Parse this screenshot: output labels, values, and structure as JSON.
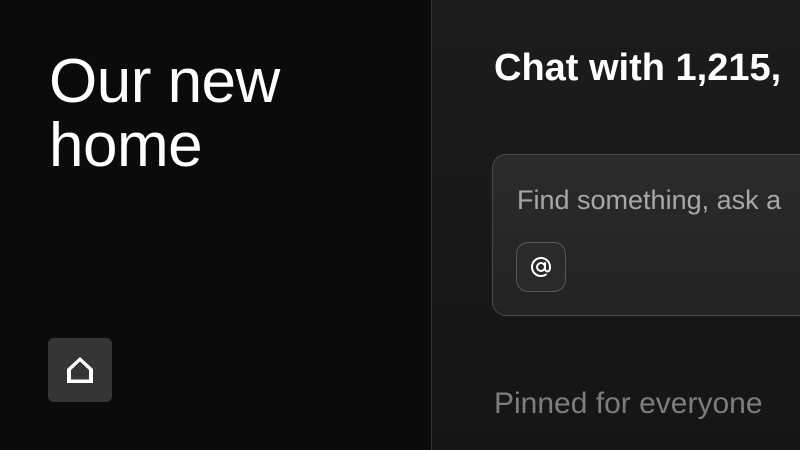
{
  "left": {
    "title": "Our new\nhome",
    "home_button": {
      "icon": "home-icon"
    }
  },
  "right": {
    "chat_title": "Chat with 1,215,",
    "search": {
      "value": "",
      "placeholder": "Find something, ask a",
      "mention_button": {
        "icon": "at-sign-icon"
      }
    },
    "pinned_heading": "Pinned for everyone"
  },
  "colors": {
    "left_background": "#0b0b0b",
    "right_background": "#1c1c1c",
    "home_button_background": "#353535",
    "search_border": "#4a4a4a",
    "text_primary": "#ffffff",
    "text_muted": "#7d7d7d"
  }
}
